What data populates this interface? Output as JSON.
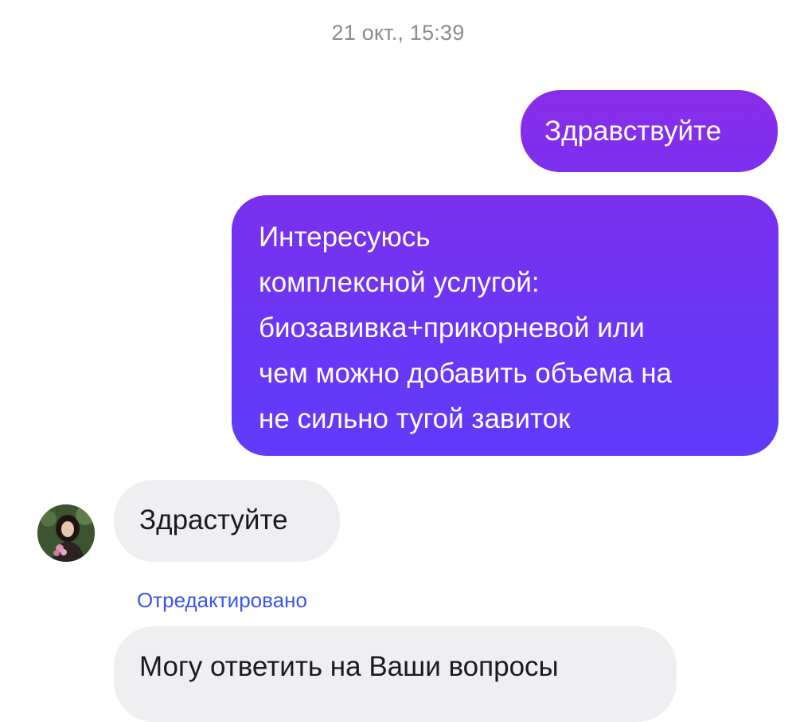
{
  "timestamp": "21 окт., 15:39",
  "messages": [
    {
      "direction": "outgoing",
      "text": "Здравствуйте"
    },
    {
      "direction": "outgoing",
      "text": "Интересуюсь\nкомплексной услугой:\nбиозавивка+прикорневой или\nчем можно добавить объема на\nне сильно тугой завиток"
    },
    {
      "direction": "incoming",
      "text": "Здрастуйте"
    },
    {
      "direction": "incoming",
      "text": "Могу ответить на Ваши вопросы",
      "edited_label": "Отредактировано"
    }
  ],
  "avatar": {
    "icon": "user-avatar-photo"
  },
  "colors": {
    "outgoing_bubble_top": "#8a2de8",
    "outgoing_bubble_bottom": "#5f3bfa",
    "incoming_bubble": "#efeff2",
    "edited_label": "#3b55e6",
    "timestamp": "#8a8a8f"
  }
}
